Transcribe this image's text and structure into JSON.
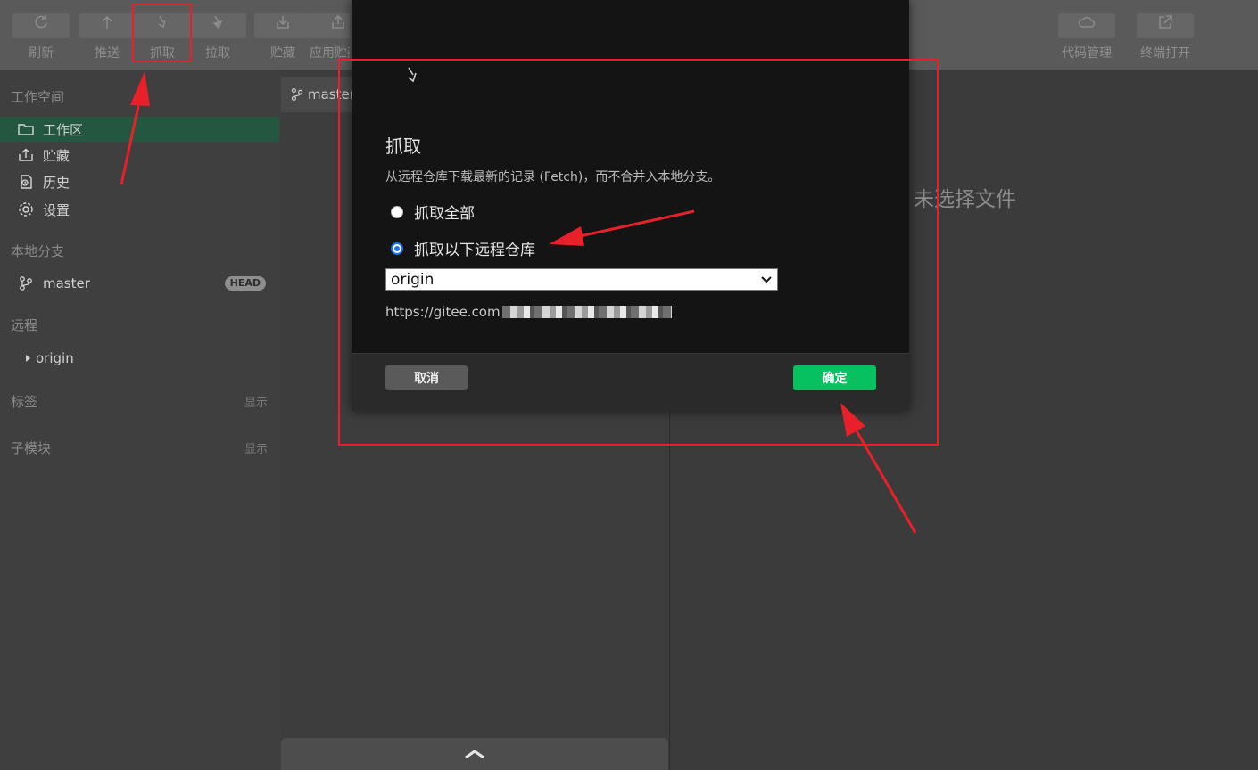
{
  "toolbar": {
    "refresh": "刷新",
    "push": "推送",
    "fetch": "抓取",
    "pull": "拉取",
    "stash": "贮藏",
    "apply_stash": "应用贮藏",
    "code_manage": "代码管理",
    "terminal_open": "终端打开"
  },
  "sidebar": {
    "workspace_title": "工作空间",
    "items": [
      "工作区",
      "贮藏",
      "历史",
      "设置"
    ],
    "local_branches_title": "本地分支",
    "branch_name": "master",
    "head_badge": "HEAD",
    "remotes_title": "远程",
    "remote_name": "origin",
    "tags_title": "标签",
    "tags_toggle": "显示",
    "submodules_title": "子模块",
    "submodules_toggle": "显示"
  },
  "middle": {
    "branch_tab": "master"
  },
  "right": {
    "empty_hint": "未选择文件"
  },
  "dialog": {
    "title": "抓取",
    "description": "从远程仓库下载最新的记录 (Fetch)，而不合并入本地分支。",
    "option_all": "抓取全部",
    "option_selected": "抓取以下远程仓库",
    "selected_option": "option_selected",
    "remote_value": "origin",
    "remote_url_prefix": "https://gitee.com",
    "cancel_label": "取消",
    "confirm_label": "确定"
  },
  "colors": {
    "accent_green": "#07c160",
    "active_nav": "#23573f",
    "annotation_red": "#e8202a",
    "radio_blue": "#1a73e8"
  }
}
